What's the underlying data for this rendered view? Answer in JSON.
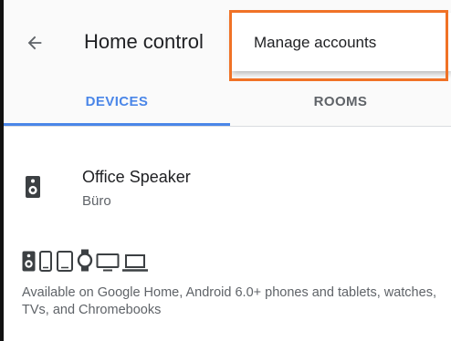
{
  "app": {
    "title": "Home control"
  },
  "tabs": [
    {
      "label": "DEVICES",
      "active": true
    },
    {
      "label": "ROOMS",
      "active": false
    }
  ],
  "device": {
    "name": "Office Speaker",
    "room": "Büro",
    "icon": "speaker-icon"
  },
  "supported_devices": {
    "icons": [
      "speaker-icon",
      "phone-icon",
      "tablet-icon",
      "watch-icon",
      "tv-icon",
      "laptop-icon"
    ],
    "text": "Available on Google Home, Android 6.0+ phones and tablets, watches, TVs, and Chromebooks"
  },
  "menu": {
    "items": [
      {
        "label": "Manage accounts"
      }
    ]
  },
  "colors": {
    "accent": "#4a86e8",
    "highlight": "#f07226",
    "text_primary": "#202124",
    "text_secondary": "#5f6368"
  }
}
